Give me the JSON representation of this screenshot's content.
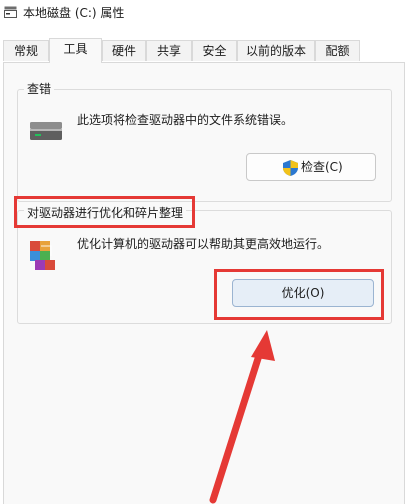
{
  "window": {
    "title": "本地磁盘 (C:) 属性",
    "icon": "drive-icon"
  },
  "tabs": [
    {
      "label": "常规",
      "active": false
    },
    {
      "label": "工具",
      "active": true
    },
    {
      "label": "硬件",
      "active": false
    },
    {
      "label": "共享",
      "active": false
    },
    {
      "label": "安全",
      "active": false
    },
    {
      "label": "以前的版本",
      "active": false
    },
    {
      "label": "配额",
      "active": false
    }
  ],
  "error_check": {
    "title": "查错",
    "description": "此选项将检查驱动器中的文件系统错误。",
    "button_label": "检查(C)",
    "icon": "hard-drive-icon",
    "button_icon": "uac-shield-icon"
  },
  "optimize": {
    "title": "对驱动器进行优化和碎片整理",
    "description": "优化计算机的驱动器可以帮助其更高效地运行。",
    "button_label": "优化(O)",
    "icon": "defrag-icon"
  },
  "colors": {
    "highlight": "#e53935",
    "panel_bg": "#f9f9f9",
    "primary_button_bg": "#e6eef7"
  }
}
